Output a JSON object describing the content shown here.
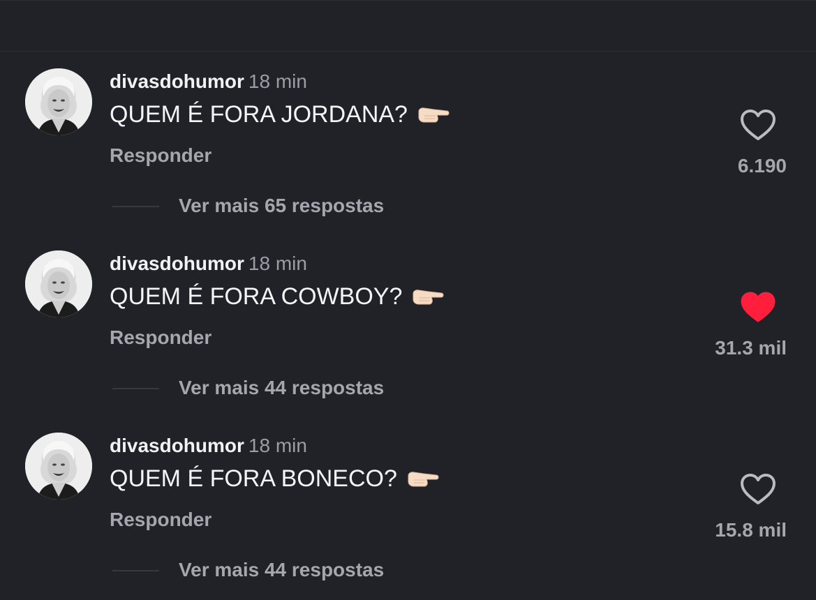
{
  "comments": [
    {
      "username": "divasdohumor",
      "time": "18 min",
      "text": "QUEM É FORA JORDANA?",
      "emoji": "pointing-right-hand-icon",
      "reply_label": "Responder",
      "more_replies": "Ver mais 65 respostas",
      "likes": "6.190",
      "liked": false
    },
    {
      "username": "divasdohumor",
      "time": "18 min",
      "text": "QUEM É FORA COWBOY?",
      "emoji": "pointing-right-hand-icon",
      "reply_label": "Responder",
      "more_replies": "Ver mais 44 respostas",
      "likes": "31.3 mil",
      "liked": true
    },
    {
      "username": "divasdohumor",
      "time": "18 min",
      "text": "QUEM É FORA BONECO?",
      "emoji": "pointing-right-hand-icon",
      "reply_label": "Responder",
      "more_replies": "Ver mais 44 respostas",
      "likes": "15.8 mil",
      "liked": false
    }
  ],
  "colors": {
    "background": "#212227",
    "liked_heart": "#ff1f3d",
    "outline_heart": "#b9bcc3"
  }
}
